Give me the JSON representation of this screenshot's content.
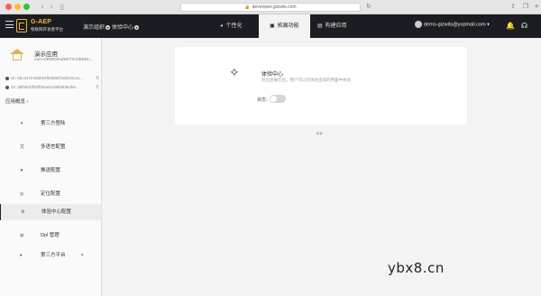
{
  "browser": {
    "url": "developer.gizwits.com"
  },
  "appbar": {
    "logo_title": "G-AEP",
    "logo_subtitle": "物联网开发者平台",
    "breadcrumb_org": "演示组织",
    "breadcrumb_project": "体验中心",
    "tabs": [
      {
        "label": "个性化",
        "icon": "palette-icon"
      },
      {
        "label": "拓展功能",
        "icon": "extension-icon"
      },
      {
        "label": "构建应用",
        "icon": "build-icon"
      }
    ],
    "active_tab": "拓展功能",
    "user_email": "demo-gizwits@yopmail.com",
    "user_dropdown": "▾"
  },
  "sidebar": {
    "app_name": "演示应用",
    "app_code": "com.DEMOGIZWITS.DEMO...",
    "id_rows": [
      {
        "label": "ID:",
        "value": "5bce47e456e94f66b96f16b8c9ca1..."
      },
      {
        "label": "ID:",
        "value": "d8f5620fb6ff054e5c26f69b8ef6e..."
      }
    ],
    "overview": "应用概览",
    "overview_chevron": "›",
    "menu": [
      {
        "label": "第三方登陆",
        "icon": "link-icon"
      },
      {
        "label": "多语言配置",
        "icon": "language-icon"
      },
      {
        "label": "推送配置",
        "icon": "push-icon"
      },
      {
        "label": "定位配置",
        "icon": "location-icon"
      },
      {
        "label": "体验中心配置",
        "icon": "experience-icon"
      },
      {
        "label": "Dpl 管理",
        "icon": "dpl-icon"
      },
      {
        "label": "第三方平台",
        "icon": "platform-icon"
      }
    ],
    "active_menu": "体验中心配置"
  },
  "card": {
    "title": "体验中心",
    "description": "开启后展示出，用户可以在体验出现的界面中体验",
    "status_label": "状态：",
    "toggle_on": false
  },
  "pager": "◀ ▶",
  "watermark": "ybx8.cn"
}
